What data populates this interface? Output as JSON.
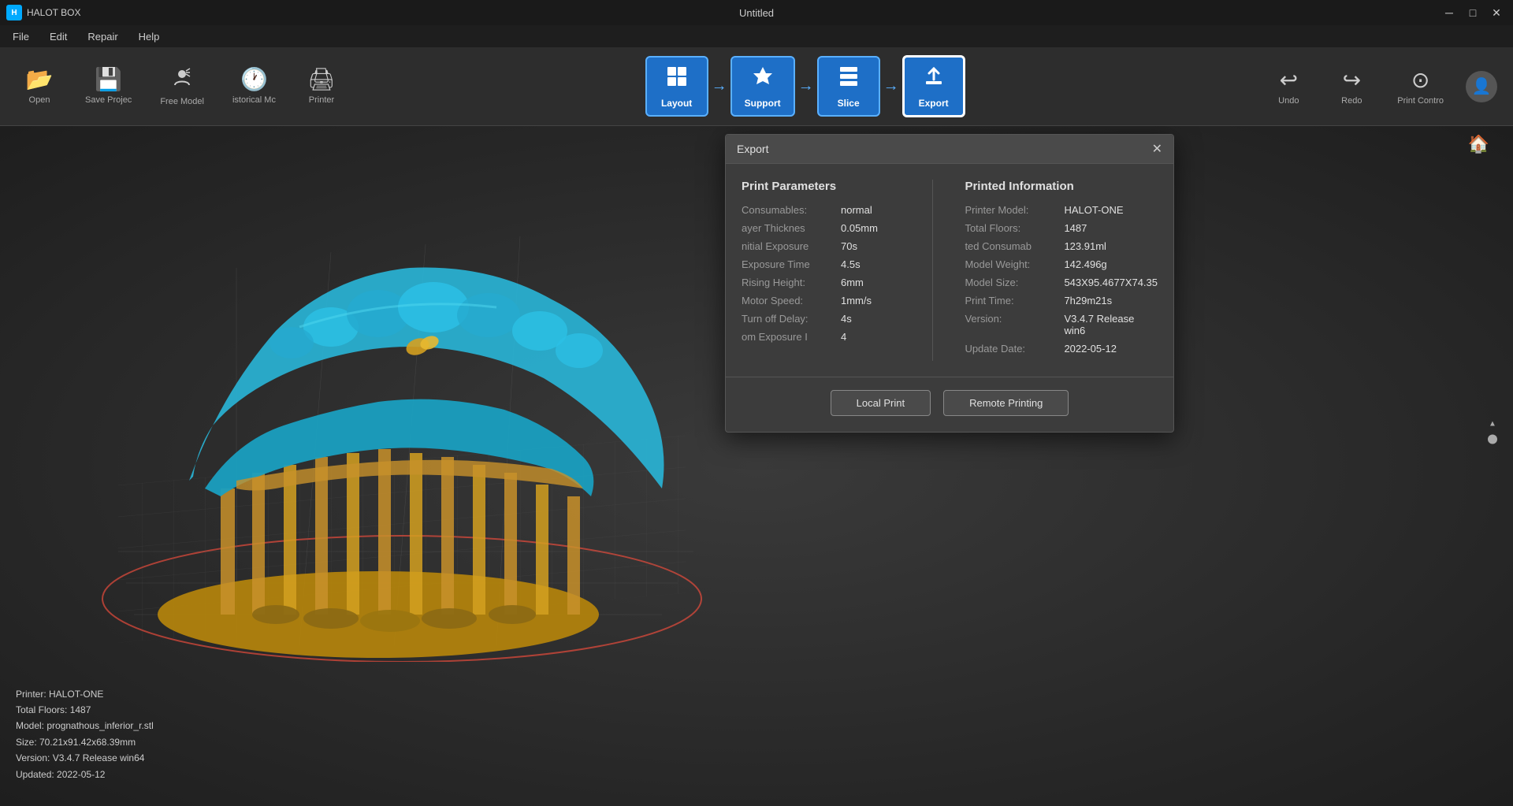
{
  "app": {
    "name": "HALOT BOX",
    "window_title": "Untitled"
  },
  "title_bar": {
    "title": "Untitled",
    "minimize_label": "─",
    "maximize_label": "□",
    "close_label": "✕"
  },
  "menu": {
    "items": [
      "File",
      "Edit",
      "Repair",
      "Help"
    ]
  },
  "toolbar_left": {
    "buttons": [
      {
        "id": "open",
        "label": "Open",
        "icon": "📂"
      },
      {
        "id": "save",
        "label": "Save Projec",
        "icon": "💾"
      },
      {
        "id": "free-model",
        "label": "Free Model",
        "icon": "🔧"
      },
      {
        "id": "historical",
        "label": "istorical Mc",
        "icon": "🕐"
      },
      {
        "id": "printer",
        "label": "Printer",
        "icon": "🖨"
      }
    ]
  },
  "workflow": {
    "steps": [
      {
        "id": "layout",
        "label": "Layout",
        "icon": "⊞"
      },
      {
        "id": "support",
        "label": "Support",
        "icon": "🔩"
      },
      {
        "id": "slice",
        "label": "Slice",
        "icon": "◫"
      },
      {
        "id": "export",
        "label": "Export",
        "icon": "⬆"
      }
    ],
    "active_step": "export"
  },
  "toolbar_right": {
    "undo_label": "Undo",
    "redo_label": "Redo",
    "print_control_label": "Print Contro"
  },
  "export_dialog": {
    "title": "Export",
    "close_label": "✕",
    "print_parameters": {
      "heading": "Print Parameters",
      "rows": [
        {
          "label": "Consumables:",
          "value": "normal"
        },
        {
          "label": "ayer Thicknes",
          "value": "0.05mm"
        },
        {
          "label": "nitial Exposure",
          "value": "70s"
        },
        {
          "label": "Exposure Time",
          "value": "4.5s"
        },
        {
          "label": "Rising Height:",
          "value": "6mm"
        },
        {
          "label": "Motor Speed:",
          "value": "1mm/s"
        },
        {
          "label": "Turn off Delay:",
          "value": "4s"
        },
        {
          "label": "om Exposure I",
          "value": "4"
        }
      ]
    },
    "printed_information": {
      "heading": "Printed Information",
      "rows": [
        {
          "label": "Printer Model:",
          "value": "HALOT-ONE"
        },
        {
          "label": "Total Floors:",
          "value": "1487"
        },
        {
          "label": "ted Consumab",
          "value": "123.91ml"
        },
        {
          "label": "Model Weight:",
          "value": "142.496g"
        },
        {
          "label": "Model Size:",
          "value": "543X95.4677X74.35"
        },
        {
          "label": "Print Time:",
          "value": "7h29m21s"
        },
        {
          "label": "Version:",
          "value": "V3.4.7 Release win6"
        },
        {
          "label": "Update Date:",
          "value": "2022-05-12"
        }
      ]
    },
    "buttons": {
      "local_print": "Local Print",
      "remote_printing": "Remote Printing"
    }
  },
  "status_bar": {
    "printer": "Printer: HALOT-ONE",
    "total_floors": "Total Floors: 1487",
    "model": "Model: prognathous_inferior_r.stl",
    "size": "Size: 70.21x91.42x68.39mm",
    "version": "Version: V3.4.7 Release win64",
    "updated": "Updated:  2022-05-12"
  },
  "colors": {
    "bg": "#2a2a2a",
    "toolbar": "#2d2d2d",
    "dialog_bg": "#3c3c3c",
    "accent_blue": "#1e6fc7",
    "model_blue": "#29b6d8",
    "model_gold": "#c8912a",
    "grid_line": "#555555"
  }
}
